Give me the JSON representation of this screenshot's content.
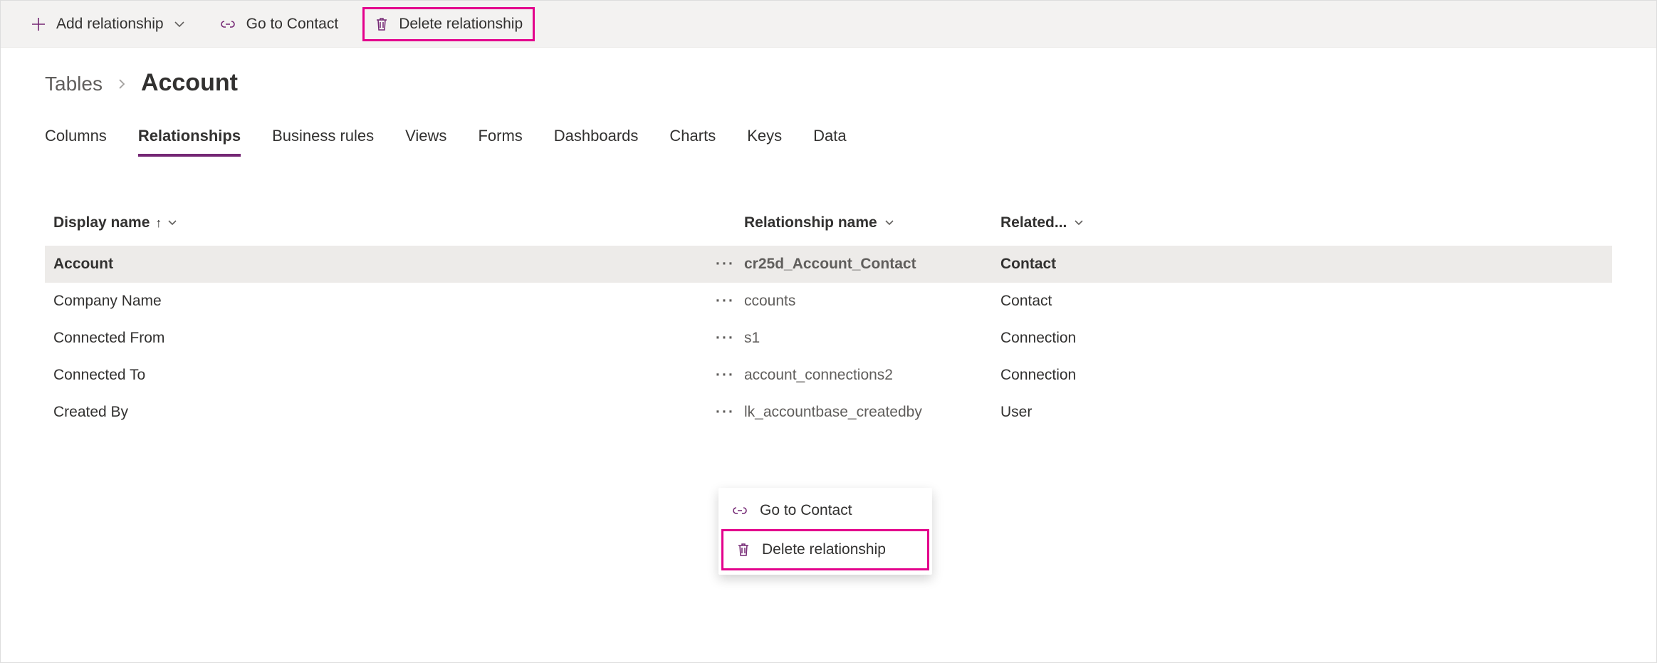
{
  "toolbar": {
    "add_relationship": "Add relationship",
    "go_to_contact": "Go to Contact",
    "delete_relationship": "Delete relationship"
  },
  "breadcrumb": {
    "root": "Tables",
    "current": "Account"
  },
  "tabs": {
    "columns": "Columns",
    "relationships": "Relationships",
    "business_rules": "Business rules",
    "views": "Views",
    "forms": "Forms",
    "dashboards": "Dashboards",
    "charts": "Charts",
    "keys": "Keys",
    "data": "Data"
  },
  "columns": {
    "display_name": "Display name",
    "relationship_name": "Relationship name",
    "related": "Related..."
  },
  "rows": [
    {
      "display": "Account",
      "rel": "cr25d_Account_Contact",
      "related": "Contact",
      "selected": true
    },
    {
      "display": "Company Name",
      "rel": "ccounts",
      "related": "Contact",
      "selected": false
    },
    {
      "display": "Connected From",
      "rel": "s1",
      "related": "Connection",
      "selected": false
    },
    {
      "display": "Connected To",
      "rel": "account_connections2",
      "related": "Connection",
      "selected": false
    },
    {
      "display": "Created By",
      "rel": "lk_accountbase_createdby",
      "related": "User",
      "selected": false
    }
  ],
  "context_menu": {
    "go_to_contact": "Go to Contact",
    "delete_relationship": "Delete relationship"
  },
  "colors": {
    "accent": "#742774",
    "highlight": "#e3008c"
  }
}
